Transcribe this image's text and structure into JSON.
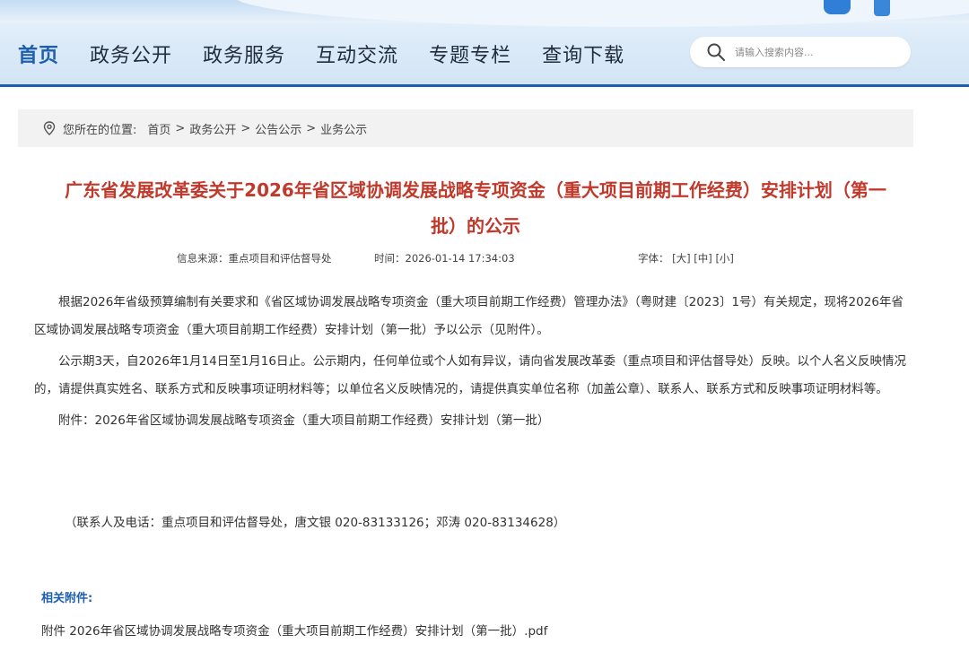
{
  "nav": {
    "items": [
      {
        "label": "首页",
        "active": true
      },
      {
        "label": "政务公开",
        "active": false
      },
      {
        "label": "政务服务",
        "active": false
      },
      {
        "label": "互动交流",
        "active": false
      },
      {
        "label": "专题专栏",
        "active": false
      },
      {
        "label": "查询下载",
        "active": false
      }
    ]
  },
  "search": {
    "placeholder": "请输入搜索内容..."
  },
  "breadcrumb": {
    "prefix": "您所在的位置:",
    "items": [
      "首页",
      "政务公开",
      "公告公示",
      "业务公示"
    ],
    "separator": ">"
  },
  "article": {
    "title_line1": "广东省发展改革委关于2026年省区域协调发展战略专项资金（重大项目前期工作经费）安排计划（第一",
    "title_line2": "批）的公示",
    "source": "信息来源：重点项目和评估督导处",
    "time": "时间：2026-01-14 17:34:03",
    "font_label": "字体：",
    "font_large": "[大]",
    "font_medium": "[中]",
    "font_small": "[小]",
    "paragraphs": [
      "根据2026年省级预算编制有关要求和《省区域协调发展战略专项资金（重大项目前期工作经费）管理办法》（粤财建〔2023〕1号）有关规定，现将2026年省区域协调发展战略专项资金（重大项目前期工作经费）安排计划（第一批）予以公示（见附件）。",
      "公示期3天，自2026年1月14日至1月16日止。公示期内，任何单位或个人如有异议，请向省发展改革委（重点项目和评估督导处）反映。以个人名义反映情况的，请提供真实姓名、联系方式和反映事项证明材料等；以单位名义反映情况的，请提供真实单位名称（加盖公章）、联系人、联系方式和反映事项证明材料等。",
      "附件：2026年省区域协调发展战略专项资金（重大项目前期工作经费）安排计划（第一批）"
    ],
    "contact": "（联系人及电话：重点项目和评估督导处，唐文银 020-83133126；邓涛 020-83134628）"
  },
  "attachments": {
    "heading": "相关附件:",
    "items": [
      "附件 2026年省区域协调发展战略专项资金（重大项目前期工作经费）安排计划（第一批）.pdf"
    ]
  },
  "colors": {
    "brand": "#1d5fae",
    "title": "#c0392b"
  }
}
